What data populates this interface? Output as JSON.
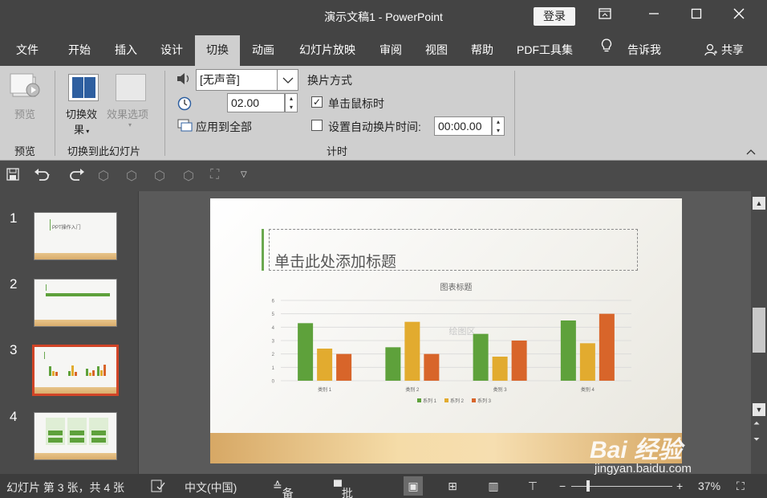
{
  "app": {
    "title": "演示文稿1  -  PowerPoint",
    "login": "登录"
  },
  "tabs": [
    "文件",
    "开始",
    "插入",
    "设计",
    "切换",
    "动画",
    "幻灯片放映",
    "审阅",
    "视图",
    "帮助",
    "PDF工具集",
    "告诉我"
  ],
  "share": "共享",
  "ribbon": {
    "preview_label": "预览",
    "preview_group": "预览",
    "effect_label_1": "切换效",
    "effect_label_2": "果",
    "options_label": "效果选项",
    "transition_group": "切换到此幻灯片",
    "sound_value": "[无声音]",
    "duration_value": "02.00",
    "apply_all": "应用到全部",
    "advance_title": "换片方式",
    "on_click_label": "单击鼠标时",
    "after_label": "设置自动换片时间:",
    "after_value": "00:00.00",
    "timing_group": "计时"
  },
  "slides": [
    {
      "number": "1",
      "thumb_text": "PPT操作入门"
    },
    {
      "number": "2"
    },
    {
      "number": "3"
    },
    {
      "number": "4"
    }
  ],
  "slide": {
    "title_placeholder": "单击此处添加标题",
    "plot_area_label": "绘图区"
  },
  "chart_data": {
    "type": "bar",
    "title": "图表标题",
    "categories": [
      "类别 1",
      "类别 2",
      "类别 3",
      "类别 4"
    ],
    "series": [
      {
        "name": "系列 1",
        "values": [
          4.3,
          2.5,
          3.5,
          4.5
        ],
        "color": "#5ea13b"
      },
      {
        "name": "系列 2",
        "values": [
          2.4,
          4.4,
          1.8,
          2.8
        ],
        "color": "#e2ab2f"
      },
      {
        "name": "系列 3",
        "values": [
          2.0,
          2.0,
          3.0,
          5.0
        ],
        "color": "#d8652a"
      }
    ],
    "ylim": [
      0,
      6
    ],
    "yticks": [
      "0",
      "1",
      "2",
      "3",
      "4",
      "5",
      "6"
    ],
    "legend": "bottom"
  },
  "status": {
    "slide_info": "幻灯片 第 3 张，共 4 张",
    "language": "中文(中国)",
    "notes": "备注",
    "comments": "批注",
    "zoom": "37%"
  },
  "watermark": {
    "main": "Bai 经验",
    "sub": "jingyan.baidu.com"
  },
  "colors": {
    "accent_tab": "#cfcfcf",
    "selected_thumb_border": "#d04427"
  }
}
